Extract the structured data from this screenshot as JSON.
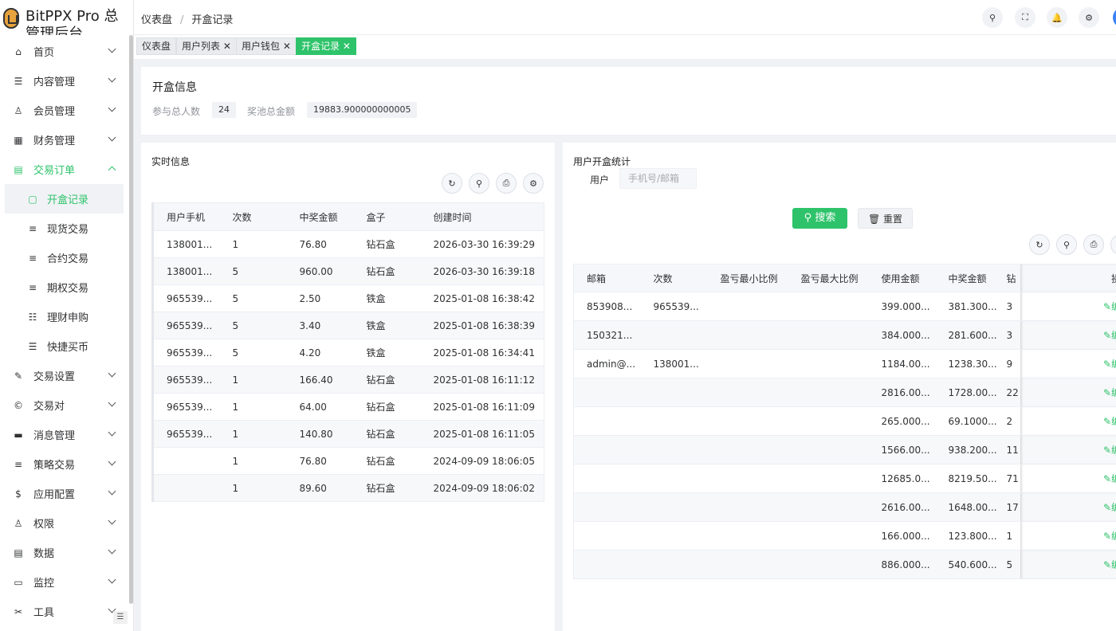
{
  "app": {
    "title": "BitPPX Pro 总管理后台"
  },
  "header": {
    "breadcrumb": [
      "仪表盘",
      "开盒记录"
    ],
    "icons": [
      "search-icon",
      "fullscreen-icon",
      "bell-icon",
      "gear-icon"
    ]
  },
  "sidebar": {
    "items": [
      {
        "label": "首页",
        "icon": "home-icon",
        "glyph": "⌂"
      },
      {
        "label": "内容管理",
        "icon": "list-icon",
        "glyph": "☰"
      },
      {
        "label": "会员管理",
        "icon": "user-icon",
        "glyph": "♙"
      },
      {
        "label": "财务管理",
        "icon": "table-icon",
        "glyph": "▦"
      },
      {
        "label": "交易订单",
        "icon": "order-icon",
        "glyph": "▤"
      }
    ],
    "sub_items": [
      {
        "label": "开盒记录",
        "glyph": "▢"
      },
      {
        "label": "现货交易",
        "glyph": "≡"
      },
      {
        "label": "合约交易",
        "glyph": "≡"
      },
      {
        "label": "期权交易",
        "glyph": "≡"
      },
      {
        "label": "理财申购",
        "glyph": "☷"
      },
      {
        "label": "快捷买币",
        "glyph": "☰"
      }
    ],
    "items_after": [
      {
        "label": "交易设置",
        "icon": "wrench-icon",
        "glyph": "✎"
      },
      {
        "label": "交易对",
        "icon": "copyright-icon",
        "glyph": "©"
      },
      {
        "label": "消息管理",
        "icon": "message-icon",
        "glyph": "▬"
      },
      {
        "label": "策略交易",
        "icon": "menu-icon",
        "glyph": "≡"
      },
      {
        "label": "应用配置",
        "icon": "dollar-icon",
        "glyph": "$"
      },
      {
        "label": "权限",
        "icon": "user-lock-icon",
        "glyph": "♙"
      },
      {
        "label": "数据",
        "icon": "database-icon",
        "glyph": "▤"
      },
      {
        "label": "监控",
        "icon": "monitor-icon",
        "glyph": "▭"
      },
      {
        "label": "工具",
        "icon": "tools-icon",
        "glyph": "✂"
      }
    ]
  },
  "tags": [
    {
      "label": "仪表盘"
    },
    {
      "label": "用户列表 ✕"
    },
    {
      "label": "用户钱包 ✕"
    },
    {
      "label": "开盒记录 ✕"
    }
  ],
  "summary": {
    "title": "开盒信息",
    "participants_label": "参与总人数",
    "participants_value": "24",
    "pool_label": "奖池总金额",
    "pool_value": "19883.900000000005"
  },
  "realtime": {
    "title": "实时信息",
    "columns": [
      "用户手机",
      "次数",
      "中奖金额",
      "盒子",
      "创建时间"
    ],
    "rows": [
      [
        "138001...",
        "1",
        "76.80",
        "钻石盒",
        "2026-03-30 16:39:29"
      ],
      [
        "138001...",
        "5",
        "960.00",
        "钻石盒",
        "2026-03-30 16:39:18"
      ],
      [
        "965539...",
        "5",
        "2.50",
        "铁盒",
        "2025-01-08 16:38:42"
      ],
      [
        "965539...",
        "5",
        "3.40",
        "铁盒",
        "2025-01-08 16:38:39"
      ],
      [
        "965539...",
        "5",
        "4.20",
        "铁盒",
        "2025-01-08 16:34:41"
      ],
      [
        "965539...",
        "1",
        "166.40",
        "钻石盒",
        "2025-01-08 16:11:12"
      ],
      [
        "965539...",
        "1",
        "64.00",
        "钻石盒",
        "2025-01-08 16:11:09"
      ],
      [
        "965539...",
        "1",
        "140.80",
        "钻石盒",
        "2025-01-08 16:11:05"
      ],
      [
        "",
        "1",
        "76.80",
        "钻石盒",
        "2024-09-09 18:06:05"
      ],
      [
        "",
        "1",
        "89.60",
        "钻石盒",
        "2024-09-09 18:06:02"
      ]
    ]
  },
  "stats": {
    "title": "用户开盒统计",
    "user_label": "用户",
    "user_placeholder": "手机号/邮箱",
    "search_label": "搜索",
    "reset_label": "重置",
    "columns": [
      "邮箱",
      "次数",
      "盈亏最小比例",
      "盈亏最大比例",
      "使用金额",
      "中奖金额",
      "钻",
      "操作"
    ],
    "edit_label": "✎编辑",
    "rows": [
      [
        "853908...",
        "965539...",
        "",
        "",
        "399.000...",
        "381.300...",
        "3"
      ],
      [
        "150321...",
        "",
        "",
        "",
        "384.000...",
        "281.600...",
        "3"
      ],
      [
        "admin@...",
        "138001...",
        "",
        "",
        "1184.00...",
        "1238.30...",
        "9"
      ],
      [
        "",
        "",
        "",
        "",
        "2816.00...",
        "1728.00...",
        "22"
      ],
      [
        "",
        "",
        "",
        "",
        "265.000...",
        "69.1000...",
        "2"
      ],
      [
        "",
        "",
        "",
        "",
        "1566.00...",
        "938.200...",
        "11"
      ],
      [
        "",
        "",
        "",
        "",
        "12685.0...",
        "8219.50...",
        "71"
      ],
      [
        "",
        "",
        "",
        "",
        "2616.00...",
        "1648.00...",
        "17"
      ],
      [
        "",
        "",
        "",
        "",
        "166.000...",
        "123.800...",
        "1"
      ],
      [
        "",
        "",
        "",
        "",
        "886.000...",
        "540.600...",
        "5"
      ]
    ]
  },
  "colors": {
    "accent": "#2ec36a"
  }
}
